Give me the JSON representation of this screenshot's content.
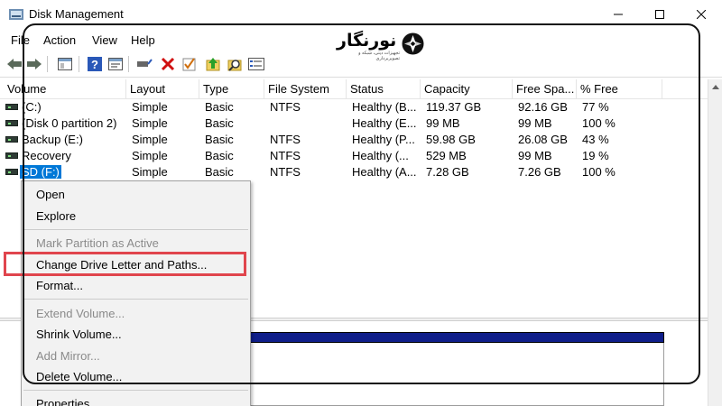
{
  "window": {
    "title": "Disk Management"
  },
  "menu": [
    "File",
    "Action",
    "View",
    "Help"
  ],
  "logo": {
    "text": "نورنگار",
    "subtitle": "تجهیزات دیتی، شبکه و تصویربرداری"
  },
  "table": {
    "columns": [
      "Volume",
      "Layout",
      "Type",
      "File System",
      "Status",
      "Capacity",
      "Free Spa...",
      "% Free"
    ],
    "rows": [
      {
        "volume": "(C:)",
        "layout": "Simple",
        "type": "Basic",
        "fs": "NTFS",
        "status": "Healthy (B...",
        "capacity": "119.37 GB",
        "free": "92.16 GB",
        "pct": "77 %"
      },
      {
        "volume": "(Disk 0 partition 2)",
        "layout": "Simple",
        "type": "Basic",
        "fs": "",
        "status": "Healthy (E...",
        "capacity": "99 MB",
        "free": "99 MB",
        "pct": "100 %"
      },
      {
        "volume": "Backup (E:)",
        "layout": "Simple",
        "type": "Basic",
        "fs": "NTFS",
        "status": "Healthy (P...",
        "capacity": "59.98 GB",
        "free": "26.08 GB",
        "pct": "43 %"
      },
      {
        "volume": "Recovery",
        "layout": "Simple",
        "type": "Basic",
        "fs": "NTFS",
        "status": "Healthy (...",
        "capacity": "529 MB",
        "free": "99 MB",
        "pct": "19 %"
      },
      {
        "volume": "SD (F:)",
        "layout": "Simple",
        "type": "Basic",
        "fs": "NTFS",
        "status": "Healthy (A...",
        "capacity": "7.28 GB",
        "free": "7.26 GB",
        "pct": "100 %"
      }
    ]
  },
  "context_menu": {
    "open": "Open",
    "explore": "Explore",
    "mark_active": "Mark Partition as Active",
    "change_letter": "Change Drive Letter and Paths...",
    "format": "Format...",
    "extend": "Extend Volume...",
    "shrink": "Shrink Volume...",
    "add_mirror": "Add Mirror...",
    "delete": "Delete Volume...",
    "properties": "Properties"
  },
  "colors": {
    "selection": "#0078d7",
    "highlight_box": "#e0454d",
    "disk_strip": "#0f1e8a"
  },
  "toolbar_icons": [
    "back-arrow-icon",
    "forward-arrow-icon",
    "console-tree-icon",
    "help-icon",
    "properties-icon",
    "connect-drive-icon",
    "delete-icon",
    "check-icon",
    "up-arrow-icon",
    "search-icon",
    "list-icon"
  ]
}
